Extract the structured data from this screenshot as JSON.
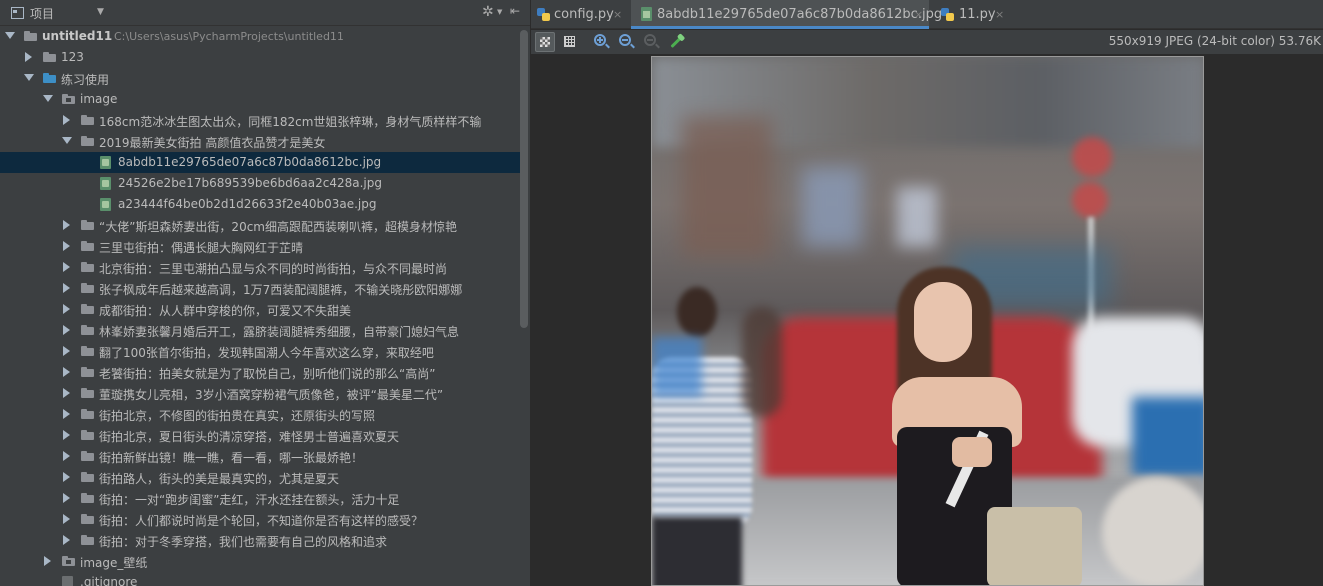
{
  "project_panel": {
    "view_label": "项目",
    "root": {
      "name": "untitled11",
      "path": "C:\\Users\\asus\\PycharmProjects\\untitled11"
    },
    "tree": [
      {
        "label": "123",
        "level": 1,
        "kind": "folder",
        "expanded": false
      },
      {
        "label": "练习使用",
        "level": 1,
        "kind": "folder-blue",
        "expanded": true
      },
      {
        "label": "image",
        "level": 2,
        "kind": "folder-res",
        "expanded": true
      },
      {
        "label": "168cm范冰冰生图太出众，同框182cm世姐张梓琳，身材气质样样不输",
        "level": 3,
        "kind": "folder",
        "expanded": false
      },
      {
        "label": "2019最新美女街拍 高颜值衣品赞才是美女",
        "level": 3,
        "kind": "folder",
        "expanded": true
      },
      {
        "label": "8abdb11e29765de07a6c87b0da8612bc.jpg",
        "level": 4,
        "kind": "image",
        "selected": true
      },
      {
        "label": "24526e2be17b689539be6bd6aa2c428a.jpg",
        "level": 4,
        "kind": "image"
      },
      {
        "label": "a23444f64be0b2d1d26633f2e40b03ae.jpg",
        "level": 4,
        "kind": "image"
      },
      {
        "label": "“大佬”斯坦森娇妻出街，20cm细高跟配西装喇叭裤，超模身材惊艳",
        "level": 3,
        "kind": "folder"
      },
      {
        "label": "三里屯街拍：偶遇长腿大胸网红于芷晴",
        "level": 3,
        "kind": "folder"
      },
      {
        "label": "北京街拍：三里屯潮拍凸显与众不同的时尚街拍，与众不同最时尚",
        "level": 3,
        "kind": "folder"
      },
      {
        "label": "张子枫成年后越来越高调，1万7西装配阔腿裤，不输关晓彤欧阳娜娜",
        "level": 3,
        "kind": "folder"
      },
      {
        "label": "成都街拍：从人群中穿梭的你，可爱又不失甜美",
        "level": 3,
        "kind": "folder"
      },
      {
        "label": "林峯娇妻张馨月婚后开工，露脐装阔腿裤秀细腰，自带豪门媳妇气息",
        "level": 3,
        "kind": "folder"
      },
      {
        "label": "翻了100张首尔街拍，发现韩国潮人今年喜欢这么穿，来取经吧",
        "level": 3,
        "kind": "folder"
      },
      {
        "label": "老饕街拍：拍美女就是为了取悦自己，别听他们说的那么“高尚”",
        "level": 3,
        "kind": "folder"
      },
      {
        "label": "董璇携女儿亮相，3岁小酒窝穿粉裙气质像爸，被评“最美星二代”",
        "level": 3,
        "kind": "folder"
      },
      {
        "label": "街拍北京，不修图的街拍贵在真实，还原街头的写照",
        "level": 3,
        "kind": "folder"
      },
      {
        "label": "街拍北京，夏日街头的清凉穿搭，难怪男士普遍喜欢夏天",
        "level": 3,
        "kind": "folder"
      },
      {
        "label": "街拍新鲜出镜！瞧一瞧，看一看，哪一张最娇艳！",
        "level": 3,
        "kind": "folder"
      },
      {
        "label": "街拍路人，街头的美是最真实的，尤其是夏天",
        "level": 3,
        "kind": "folder"
      },
      {
        "label": "街拍：一对“跑步闺蜜”走红，汗水还挂在额头，活力十足",
        "level": 3,
        "kind": "folder"
      },
      {
        "label": "街拍：人们都说时尚是个轮回，不知道你是否有这样的感受？",
        "level": 3,
        "kind": "folder"
      },
      {
        "label": "街拍：对于冬季穿搭，我们也需要有自己的风格和追求",
        "level": 3,
        "kind": "folder"
      },
      {
        "label": "image_壁纸",
        "level": 2,
        "kind": "folder-res",
        "expanded": false
      },
      {
        "label": ".gitignore",
        "level": 2,
        "kind": "file"
      }
    ]
  },
  "editor": {
    "tabs": [
      {
        "label": "config.py",
        "icon": "python-file-icon",
        "active": false
      },
      {
        "label": "8abdb11e29765de07a6c87b0da8612bc.jpg",
        "icon": "image-file-icon",
        "active": true
      },
      {
        "label": "11.py",
        "icon": "python-file-icon",
        "active": false
      }
    ],
    "close_glyph": "×",
    "image_info": "550x919 JPEG (24-bit color) 53.76K"
  },
  "colors": {
    "accent": "#4a88c7",
    "selection": "#0d293e",
    "panel_bg": "#3c3f41",
    "editor_bg": "#2b2b2b"
  }
}
